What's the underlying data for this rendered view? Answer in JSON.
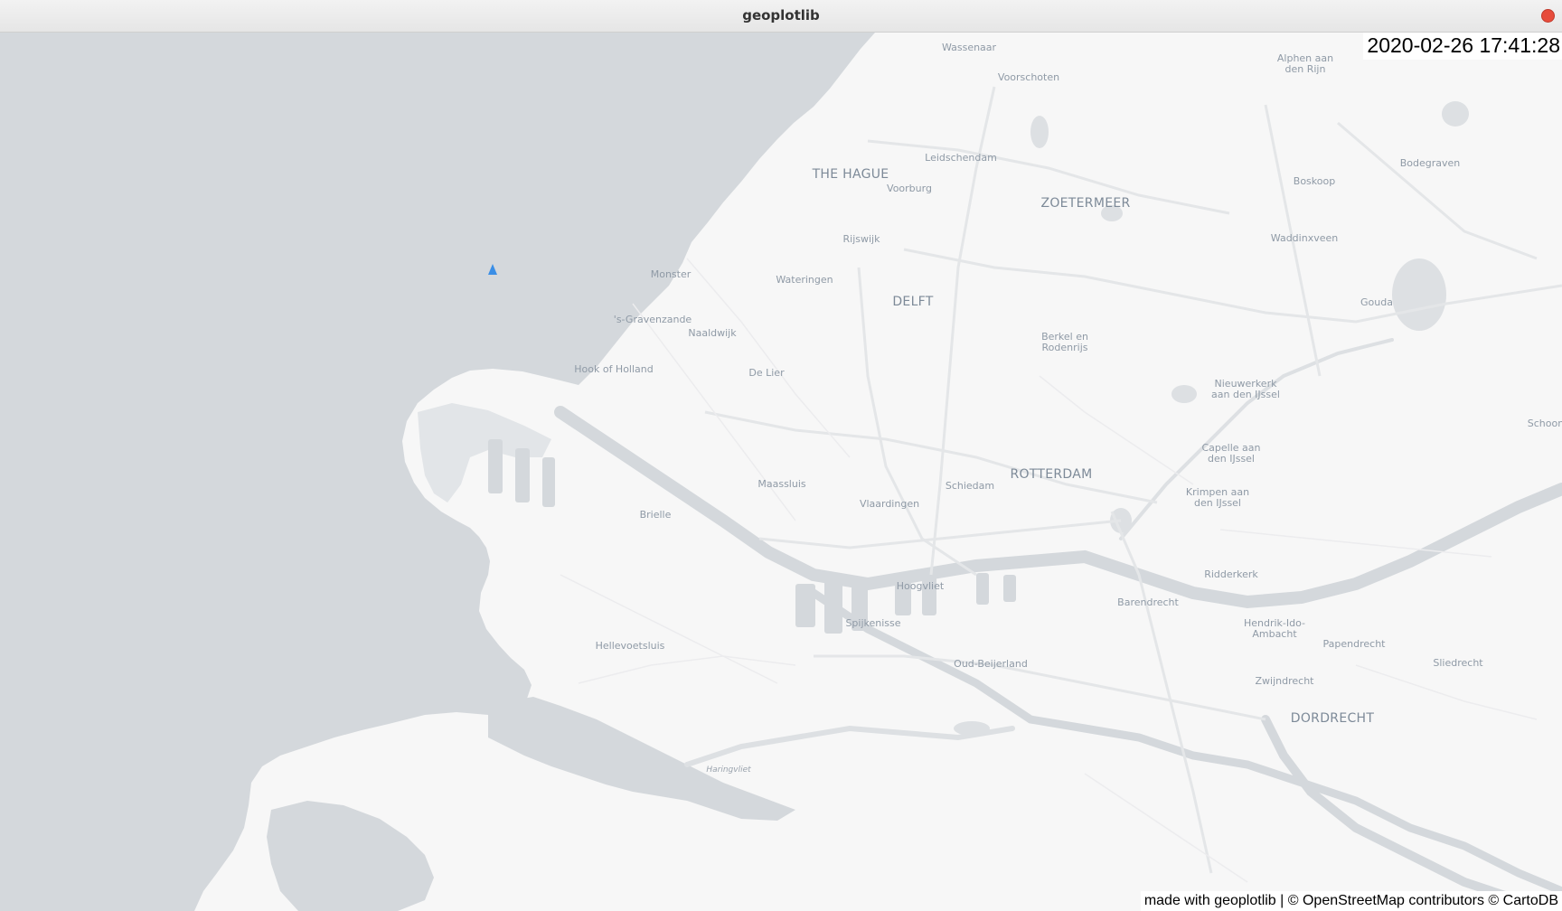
{
  "window": {
    "title": "geoplotlib"
  },
  "overlay": {
    "timestamp": "2020-02-26 17:41:28",
    "attribution": "made with geoplotlib | © OpenStreetMap contributors © CartoDB"
  },
  "map": {
    "style": "light",
    "colors": {
      "land": "#f7f7f7",
      "water": "#d4d8dc",
      "road": "#e4e6e8",
      "marker": "#3a8ee6",
      "label": "#8f9aa6"
    },
    "markers": [
      {
        "name": "vessel-marker",
        "icon": "triangle-marker-icon"
      }
    ],
    "labels": {
      "wassenaar": "Wassenaar",
      "voorschoten": "Voorschoten",
      "alphen": [
        "Alphen aan",
        "den Rijn"
      ],
      "the_hague": "THE HAGUE",
      "leidschendam": "Leidschendam",
      "bodegraven": "Bodegraven",
      "voorburg": "Voorburg",
      "boskoop": "Boskoop",
      "zoetermeer": "ZOETERMEER",
      "rijswijk": "Rijswijk",
      "waddinxveen": "Waddinxveen",
      "monster": "Monster",
      "wateringen": "Wateringen",
      "delft": "DELFT",
      "gouda": "Gouda",
      "gravenzande": "'s-Gravenzande",
      "naaldwijk": "Naaldwijk",
      "berkel": [
        "Berkel en",
        "Rodenrijs"
      ],
      "hook_of_holland": "Hook of Holland",
      "de_lier": "De Lier",
      "nieuwerkerk": [
        "Nieuwerkerk",
        "aan den IJssel"
      ],
      "schoon": "Schoon",
      "capelle": [
        "Capelle aan",
        "den IJssel"
      ],
      "maassluis": "Maassluis",
      "schiedam": "Schiedam",
      "rotterdam": "ROTTERDAM",
      "krimpen": [
        "Krimpen aan",
        "den IJssel"
      ],
      "vlaardingen": "Vlaardingen",
      "brielle": "Brielle",
      "ridderkerk": "Ridderkerk",
      "hoogvliet": "Hoogvliet",
      "barendrecht": "Barendrecht",
      "spijkenisse": "Spijkenisse",
      "hendrik": [
        "Hendrik-Ido-",
        "Ambacht"
      ],
      "hellevoetsluis": "Hellevoetsluis",
      "papendrecht": "Papendrecht",
      "sliedrecht": "Sliedrecht",
      "oud_beijerland": "Oud-Beijerland",
      "zwijndrecht": "Zwijndrecht",
      "dordrecht": "DORDRECHT",
      "haringvliet": "Haringvliet"
    }
  }
}
